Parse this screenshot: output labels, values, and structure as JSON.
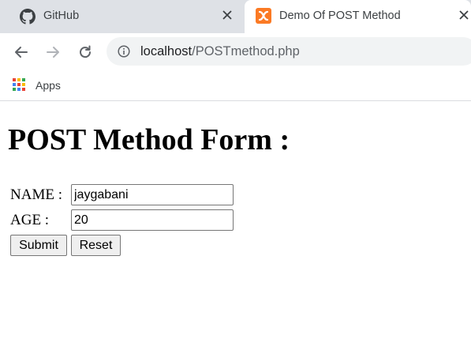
{
  "tabs": [
    {
      "title": "GitHub",
      "icon": "github-icon",
      "active": false
    },
    {
      "title": "Demo Of POST Method",
      "icon": "xampp-icon",
      "active": true
    }
  ],
  "toolbar": {
    "url_host": "localhost",
    "url_path": "/POSTmethod.php"
  },
  "bookmarks": {
    "apps_label": "Apps",
    "apps_colors": [
      "#ea4335",
      "#fbbc05",
      "#34a853",
      "#4285f4",
      "#ea4335",
      "#fbbc05",
      "#34a853",
      "#4285f4",
      "#ea4335"
    ]
  },
  "page": {
    "heading": "POST Method Form :",
    "name_label": "NAME :",
    "name_value": "jaygabani",
    "age_label": "AGE :",
    "age_value": "20",
    "submit_label": "Submit",
    "reset_label": "Reset"
  },
  "colors": {
    "tabstrip_bg": "#dee1e6",
    "omnibox_bg": "#f1f3f4",
    "xampp_orange": "#fb7a24"
  }
}
